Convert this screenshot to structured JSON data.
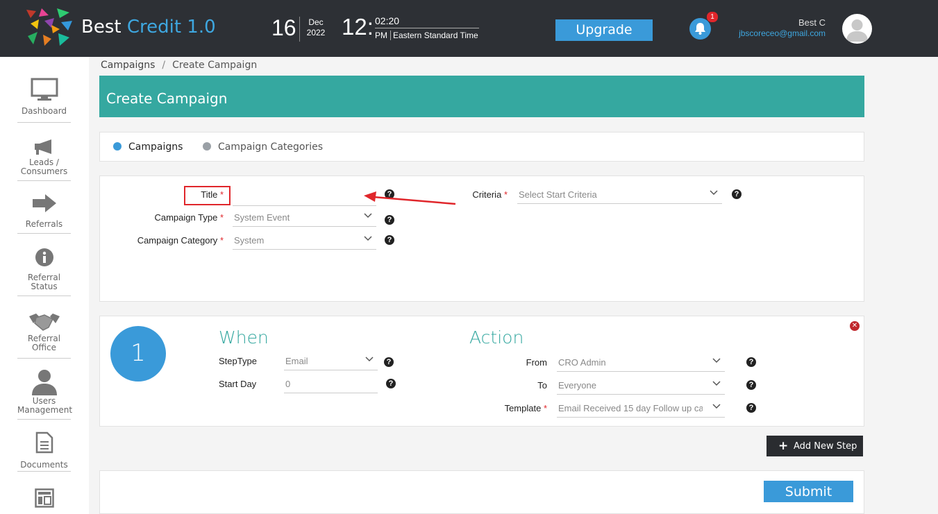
{
  "header": {
    "brand_name": "Best",
    "brand_version": "Credit 1.0",
    "date_day": "16",
    "date_month": "Dec",
    "date_year": "2022",
    "time_hour": "12:",
    "time_minute": "02:20",
    "time_ampm": "PM",
    "time_zone": "Eastern Standard Time",
    "upgrade_label": "Upgrade",
    "notification_count": "1",
    "user_name": "Best C",
    "user_email": "jbscoreceo@gmail.com"
  },
  "sidebar": {
    "items": [
      {
        "label": "Dashboard",
        "icon": "monitor-icon"
      },
      {
        "label": "Leads /",
        "label2": "Consumers",
        "icon": "megaphone-icon"
      },
      {
        "label": "Referrals",
        "icon": "arrow-right-icon"
      },
      {
        "label": "Referral",
        "label2": "Status",
        "icon": "info-icon"
      },
      {
        "label": "Referral",
        "label2": "Office",
        "icon": "handshake-icon"
      },
      {
        "label": "Users",
        "label2": "Management",
        "icon": "user-icon"
      },
      {
        "label": "Documents",
        "icon": "document-icon"
      },
      {
        "label": "",
        "icon": "layout-icon"
      }
    ]
  },
  "breadcrumb": {
    "parent": "Campaigns",
    "separator": "/",
    "current": "Create Campaign"
  },
  "page": {
    "title": "Create Campaign"
  },
  "tabs": [
    {
      "label": "Campaigns",
      "active": true,
      "color": "#3a9ad9"
    },
    {
      "label": "Campaign Categories",
      "active": false,
      "color": "#9aa0a6"
    }
  ],
  "form": {
    "title_label": "Title",
    "title_value": "",
    "campaign_type_label": "Campaign Type",
    "campaign_type_value": "System Event",
    "campaign_category_label": "Campaign Category",
    "campaign_category_value": "System",
    "criteria_label": "Criteria",
    "criteria_placeholder": "Select Start Criteria",
    "required_mark": "*",
    "help_glyph": "?"
  },
  "step": {
    "number": "1",
    "when_title": "When",
    "action_title": "Action",
    "steptype_label": "StepType",
    "steptype_value": "Email",
    "startday_label": "Start Day",
    "startday_value": "0",
    "from_label": "From",
    "from_value": "CRO Admin",
    "to_label": "To",
    "to_value": "Everyone",
    "template_label": "Template",
    "template_value": "Email Received 15 day Follow up ca",
    "close_glyph": "✕"
  },
  "actions": {
    "add_step_plus": "+",
    "add_step_label": "Add New Step",
    "submit_label": "Submit"
  },
  "colors": {
    "header_bg": "#2d3035",
    "accent_blue": "#3a9ad9",
    "teal": "#35a8a0",
    "required_red": "#e0262b"
  }
}
